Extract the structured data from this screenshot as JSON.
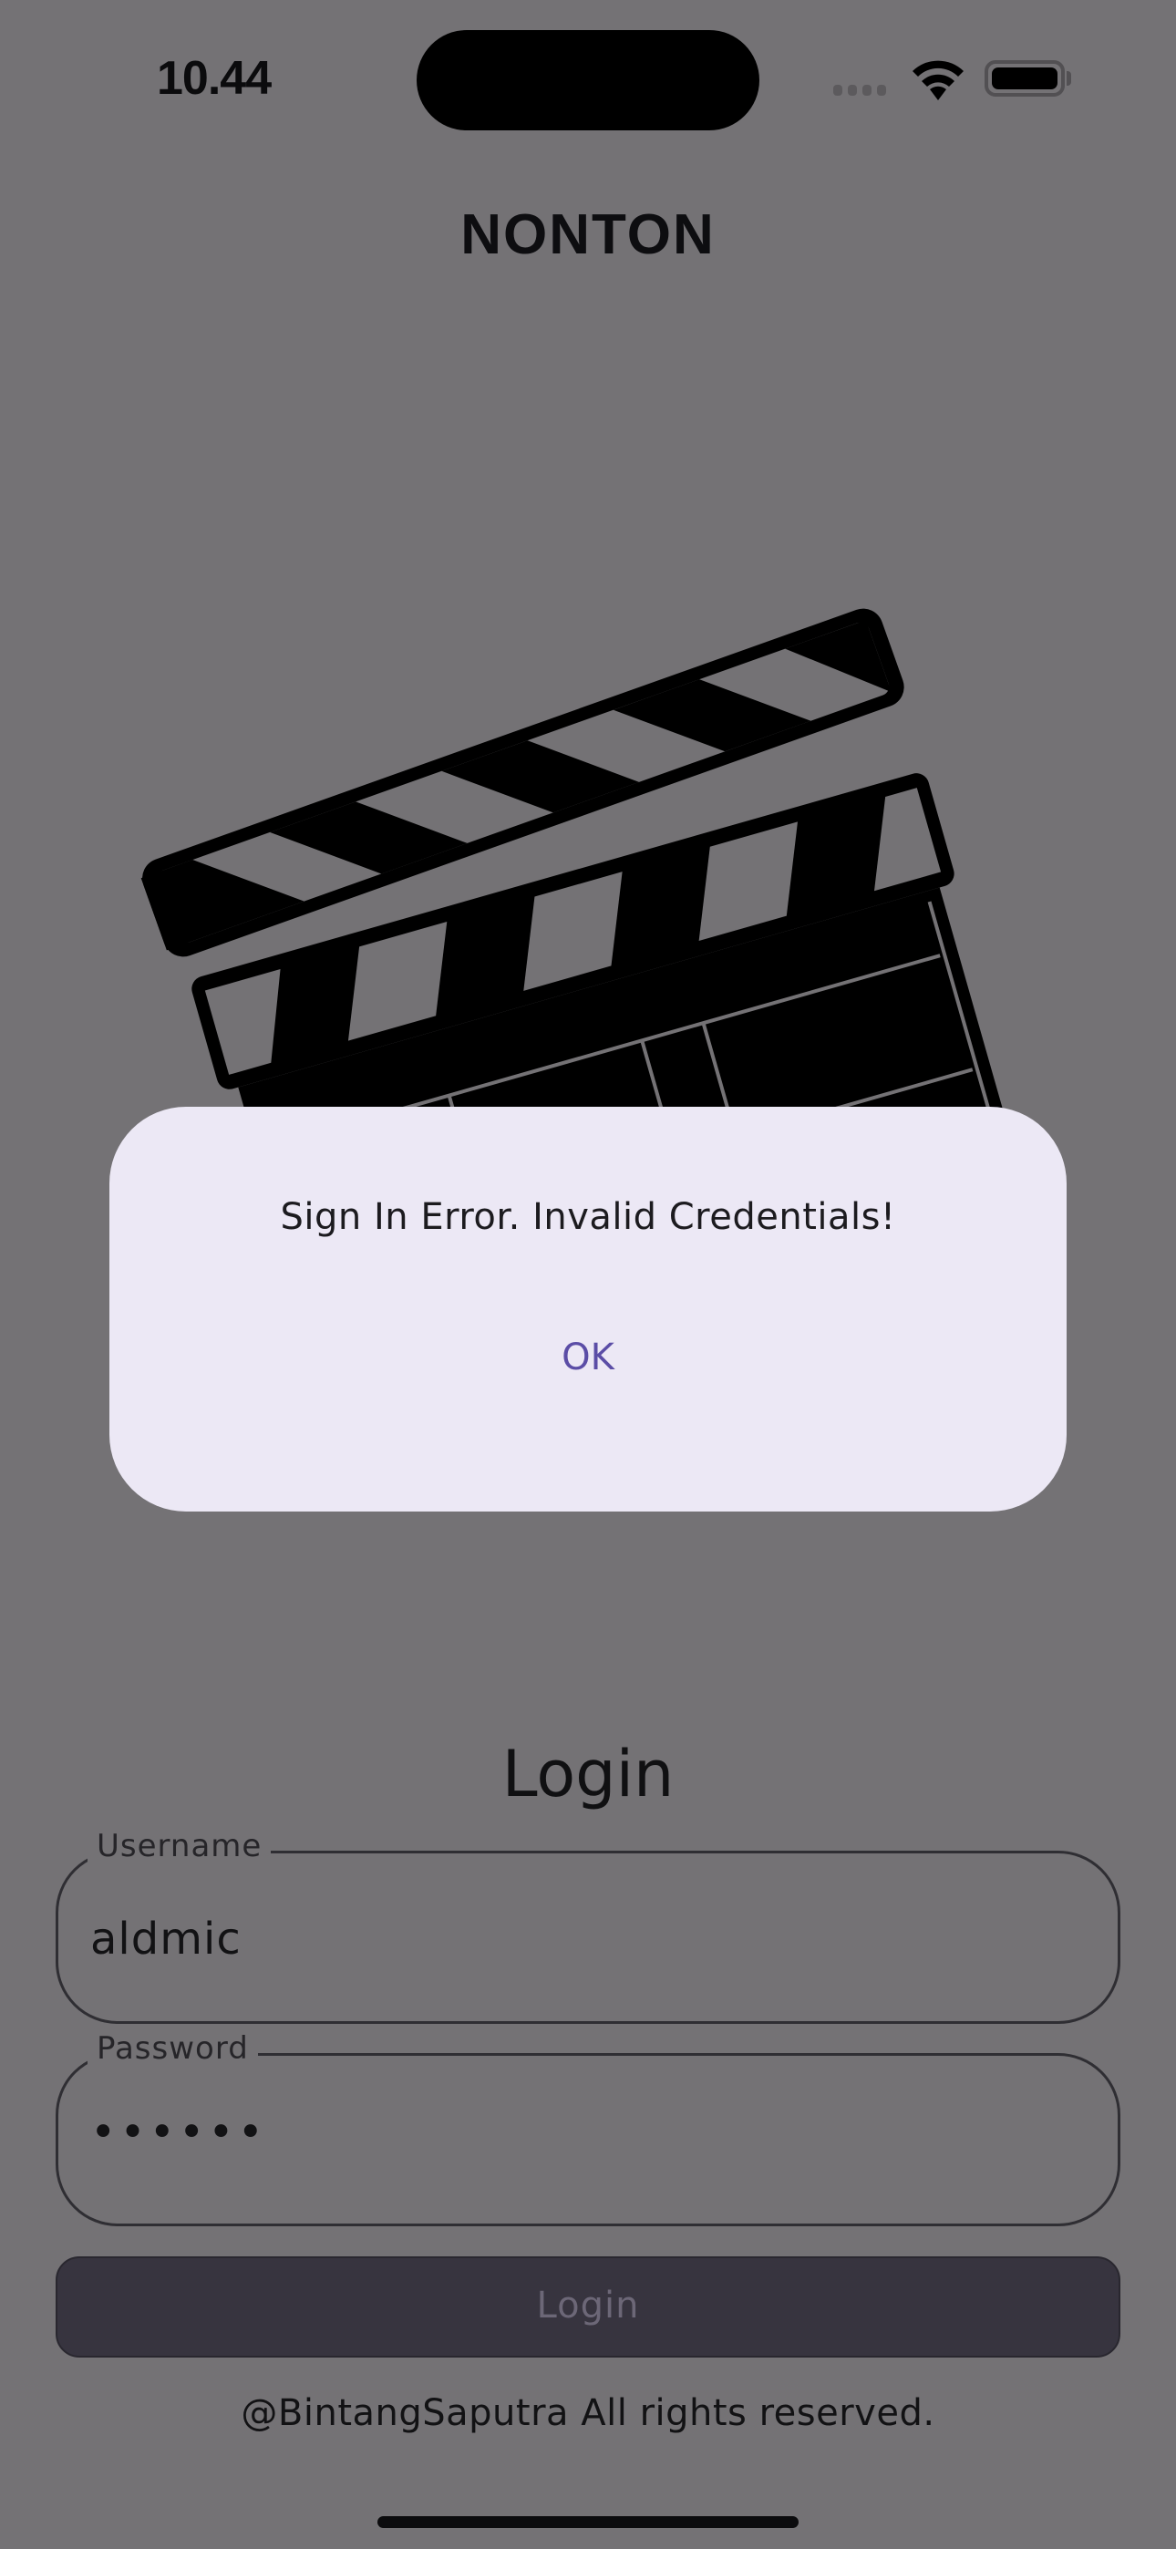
{
  "status_bar": {
    "time": "10.44",
    "icons": [
      "signal-icon",
      "wifi-icon",
      "battery-icon"
    ]
  },
  "app": {
    "title": "NONTON",
    "logo": "clapperboard-icon"
  },
  "dialog": {
    "message": "Sign In Error. Invalid Credentials!",
    "ok_label": "OK",
    "accent": "#5B4DA6",
    "background": "#ECE8F5"
  },
  "login": {
    "heading": "Login",
    "username": {
      "label": "Username",
      "value": "aldmic"
    },
    "password": {
      "label": "Password",
      "value": "••••••"
    },
    "button_label": "Login"
  },
  "footer": {
    "text": "@BintangSaputra All rights reserved."
  },
  "colors": {
    "overlay_background": "#747275",
    "button": "#37343F"
  }
}
